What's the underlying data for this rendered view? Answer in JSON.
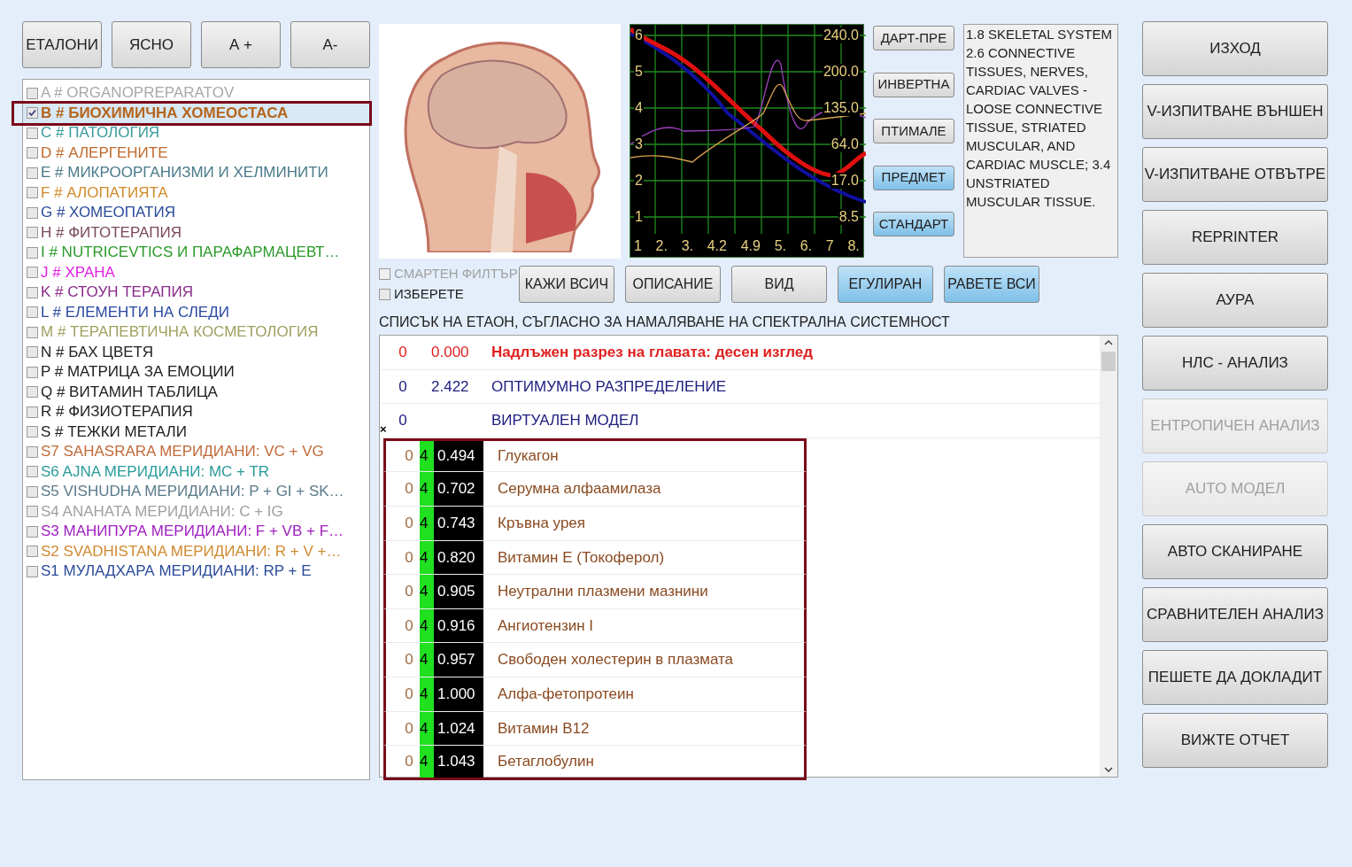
{
  "top_buttons": [
    {
      "label": "ЕТАЛОНИ"
    },
    {
      "label": "ЯСНО"
    },
    {
      "label": "А +"
    },
    {
      "label": "А-"
    }
  ],
  "categories": [
    {
      "label": "A # ORGANOPREPARATOV",
      "checked": false,
      "selected": false,
      "framed": false,
      "color": "#a8a8a8"
    },
    {
      "label": "B # БИОХИМИЧНА ХОМЕОСТАСА",
      "checked": true,
      "selected": true,
      "framed": true,
      "color": "#b5651d"
    },
    {
      "label": "C # ПАТОЛОГИЯ",
      "checked": false,
      "selected": false,
      "framed": false,
      "color": "#3a9a9a"
    },
    {
      "label": "D # АЛЕРГЕНИТЕ",
      "checked": false,
      "selected": false,
      "framed": false,
      "color": "#c0692a"
    },
    {
      "label": "E # МИКРООРГАНИЗМИ И ХЕЛМИНИТИ",
      "checked": false,
      "selected": false,
      "framed": false,
      "color": "#4a7a8a"
    },
    {
      "label": "F # АЛОПАТИЯТА",
      "checked": false,
      "selected": false,
      "framed": false,
      "color": "#d08a2a"
    },
    {
      "label": "G # ХОМЕОПАТИЯ",
      "checked": false,
      "selected": false,
      "framed": false,
      "color": "#2a4a9a"
    },
    {
      "label": "H # ФИТОТЕРАПИЯ",
      "checked": false,
      "selected": false,
      "framed": false,
      "color": "#7a4a5a"
    },
    {
      "label": "I # NUTRICEVTICS И ПАРАФАРМАЦЕВТ…",
      "checked": false,
      "selected": false,
      "framed": false,
      "color": "#2a9a2a"
    },
    {
      "label": "J # ХРАНА",
      "checked": false,
      "selected": false,
      "framed": false,
      "color": "#e020e0"
    },
    {
      "label": "K # СТОУН ТЕРАПИЯ",
      "checked": false,
      "selected": false,
      "framed": false,
      "color": "#8a2a8a"
    },
    {
      "label": "L # ЕЛЕМЕНТИ НА СЛЕДИ",
      "checked": false,
      "selected": false,
      "framed": false,
      "color": "#2a4aa0"
    },
    {
      "label": "M # ТЕРАПЕВТИЧНА КОСМЕТОЛОГИЯ",
      "checked": false,
      "selected": false,
      "framed": false,
      "color": "#a0a060"
    },
    {
      "label": "N # БАХ ЦВЕТЯ",
      "checked": false,
      "selected": false,
      "framed": false,
      "color": "#202020"
    },
    {
      "label": "P # МАТРИЦА ЗА ЕМОЦИИ",
      "checked": false,
      "selected": false,
      "framed": false,
      "color": "#202020"
    },
    {
      "label": "Q # ВИТАМИН ТАБЛИЦА",
      "checked": false,
      "selected": false,
      "framed": false,
      "color": "#202020"
    },
    {
      "label": "R # ФИЗИОТЕРАПИЯ",
      "checked": false,
      "selected": false,
      "framed": false,
      "color": "#202020"
    },
    {
      "label": "S # ТЕЖКИ МЕТАЛИ",
      "checked": false,
      "selected": false,
      "framed": false,
      "color": "#202020"
    },
    {
      "label": "S7 SAHASRARA МЕРИДИАНИ: VC + VG",
      "checked": false,
      "selected": false,
      "framed": false,
      "color": "#c06a3a"
    },
    {
      "label": "S6 AJNA МЕРИДИАНИ: MC + TR",
      "checked": false,
      "selected": false,
      "framed": false,
      "color": "#2a9a9a"
    },
    {
      "label": "S5 VISHUDHA МЕРИДИАНИ: P + GI + SK…",
      "checked": false,
      "selected": false,
      "framed": false,
      "color": "#5a7a8a"
    },
    {
      "label": "S4 ANAHATA МЕРИДИАНИ: C + IG",
      "checked": false,
      "selected": false,
      "framed": false,
      "color": "#a0a0a0"
    },
    {
      "label": "S3 МАНИПУРА МЕРИДИАНИ: F + VB + F…",
      "checked": false,
      "selected": false,
      "framed": false,
      "color": "#a020c0"
    },
    {
      "label": "S2 SVADHISTANA МЕРИДИАНИ: R + V +…",
      "checked": false,
      "selected": false,
      "framed": false,
      "color": "#d08a30"
    },
    {
      "label": "S1 МУЛАДХАРА МЕРИДИАНИ: RP + E",
      "checked": false,
      "selected": false,
      "framed": false,
      "color": "#2a4a9a"
    }
  ],
  "graph": {
    "left_labels": [
      "6",
      "5",
      "4",
      "3",
      "2",
      "1"
    ],
    "right_labels": [
      "240.0",
      "200.0",
      "135.0",
      "64.0",
      "17.0",
      "8.5"
    ],
    "x_labels": [
      "1",
      "2.",
      "3.",
      "4.2",
      "4.9",
      "5.",
      "6.",
      "7",
      "8."
    ]
  },
  "graph_buttons": [
    {
      "label": "ДАРТ-ПРЕ",
      "highlighted": false
    },
    {
      "label": "ИНВЕРТНА",
      "highlighted": false
    },
    {
      "label": "ПТИМАЛЕ",
      "highlighted": false
    },
    {
      "label": "ПРЕДМЕТ",
      "highlighted": true
    },
    {
      "label": "СТАНДАРТ",
      "highlighted": true
    }
  ],
  "description": "1.8 SKELETAL SYSTEM 2.6 CONNECTIVE TISSUES, NERVES, CARDIAC VALVES - LOOSE CONNECTIVE TISSUE, STRIATED MUSCULAR, AND CARDIAC MUSCLE; 3.4 UNSTRIATED MUSCULAR TISSUE.",
  "options": [
    {
      "label": "СМАРТЕН ФИЛТЪР",
      "checked": false,
      "disabled": true
    },
    {
      "label": "ИЗБЕРЕТЕ",
      "checked": false,
      "disabled": false
    }
  ],
  "action_buttons": [
    {
      "label": "КАЖИ ВСИЧ",
      "highlighted": false
    },
    {
      "label": "ОПИСАНИЕ",
      "highlighted": false
    },
    {
      "label": "ВИД",
      "highlighted": false
    },
    {
      "label": "ЕГУЛИРАН",
      "highlighted": true
    },
    {
      "label": "РАВЕТЕ ВСИ",
      "highlighted": true
    }
  ],
  "list_heading": "СПИСЪК НА ЕТАОН, СЪГЛАСНО ЗА НАМАЛЯВАНЕ НА СПЕКТРАЛНА СИСТЕМНОСТ",
  "rows": [
    {
      "kind": "title",
      "marker": "",
      "col1": "0",
      "col2": "",
      "value": "0.000",
      "name": "Надлъжен разрез на главата: десен изглед",
      "framed": false
    },
    {
      "kind": "summary",
      "marker": "",
      "col1": "0",
      "col2": "",
      "value": "2.422",
      "name": "ОПТИМУМНО РАЗПРЕДЕЛЕНИЕ",
      "framed": false
    },
    {
      "kind": "summary",
      "marker": "×",
      "col1": "0",
      "col2": "",
      "value": "",
      "name": "ВИРТУАЛЕН МОДЕЛ",
      "framed": false
    },
    {
      "kind": "item",
      "marker": "",
      "col1": "0",
      "col2": "4",
      "value": "0.494",
      "name": "Глукагон",
      "framed": true
    },
    {
      "kind": "item",
      "marker": "",
      "col1": "0",
      "col2": "4",
      "value": "0.702",
      "name": "Серумна алфаамилаза",
      "framed": true
    },
    {
      "kind": "item",
      "marker": "",
      "col1": "0",
      "col2": "4",
      "value": "0.743",
      "name": "Кръвна урея",
      "framed": true
    },
    {
      "kind": "item",
      "marker": "",
      "col1": "0",
      "col2": "4",
      "value": "0.820",
      "name": "Витамин Е (Токоферол)",
      "framed": true
    },
    {
      "kind": "item",
      "marker": "",
      "col1": "0",
      "col2": "4",
      "value": "0.905",
      "name": "Неутрални плазмени мазнини",
      "framed": true
    },
    {
      "kind": "item",
      "marker": "",
      "col1": "0",
      "col2": "4",
      "value": "0.916",
      "name": "Ангиотензин I",
      "framed": true
    },
    {
      "kind": "item",
      "marker": "",
      "col1": "0",
      "col2": "4",
      "value": "0.957",
      "name": "Свободен холестерин в плазмата",
      "framed": true
    },
    {
      "kind": "item",
      "marker": "",
      "col1": "0",
      "col2": "4",
      "value": "1.000",
      "name": "Алфа-фетопротеин",
      "framed": true
    },
    {
      "kind": "item",
      "marker": "",
      "col1": "0",
      "col2": "4",
      "value": "1.024",
      "name": "Витамин В12",
      "framed": true
    },
    {
      "kind": "item",
      "marker": "",
      "col1": "0",
      "col2": "4",
      "value": "1.043",
      "name": "Бетаглобулин",
      "framed": true
    }
  ],
  "side_buttons": [
    {
      "label": "ИЗХОД",
      "disabled": false
    },
    {
      "label": "V-ИЗПИТВАНЕ ВЪНШЕН",
      "disabled": false
    },
    {
      "label": "V-ИЗПИТВАНЕ ОТВЪТРЕ",
      "disabled": false
    },
    {
      "label": "REPRINTER",
      "disabled": false
    },
    {
      "label": "АУРА",
      "disabled": false
    },
    {
      "label": "НЛС - АНАЛИЗ",
      "disabled": false
    },
    {
      "label": "ЕНТРОПИЧЕН АНАЛИЗ",
      "disabled": true
    },
    {
      "label": "AUTO МОДЕЛ",
      "disabled": true
    },
    {
      "label": "АВТО СКАНИРАНЕ",
      "disabled": false
    },
    {
      "label": "СРАВНИТЕЛЕН АНАЛИЗ",
      "disabled": false
    },
    {
      "label": "ПЕШЕТЕ ДА ДОКЛАДИТ",
      "disabled": false
    },
    {
      "label": "ВИЖТЕ ОТЧЕТ",
      "disabled": false
    }
  ]
}
